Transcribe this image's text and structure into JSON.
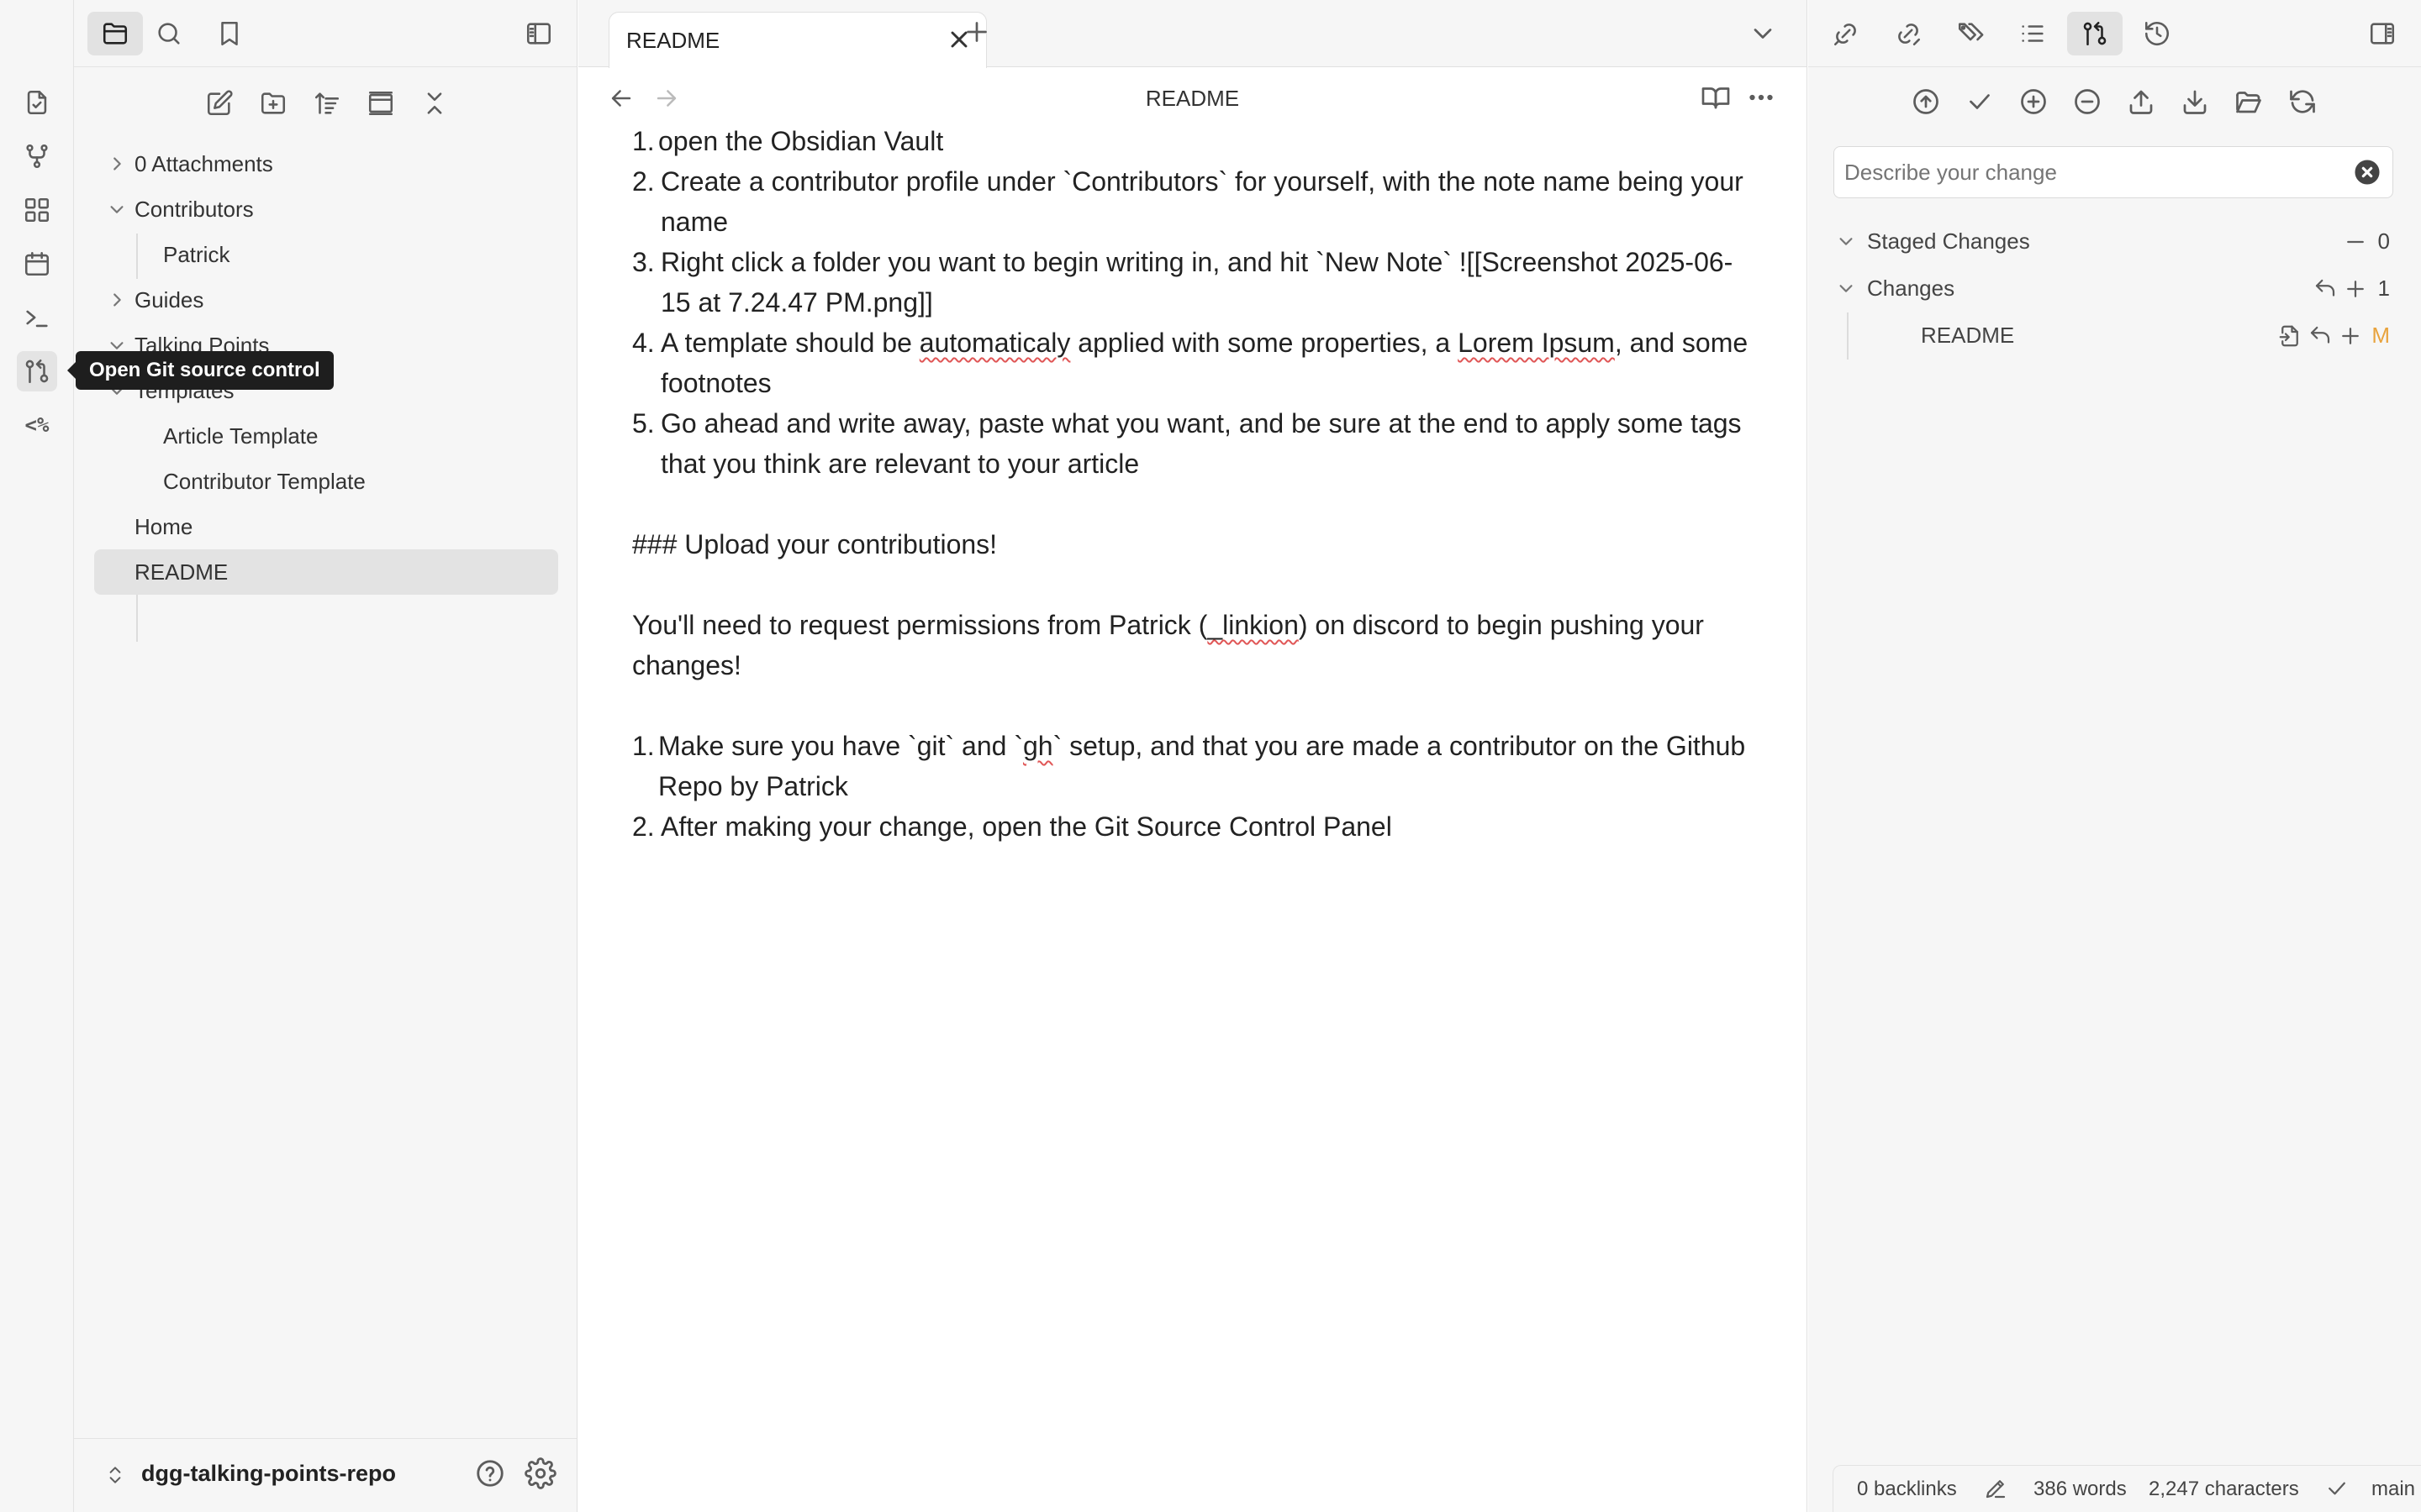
{
  "tooltip": "Open Git source control",
  "ribbon": {
    "template_label": "<%"
  },
  "left_panel": {
    "tree": [
      {
        "label": "0 Attachments",
        "type": "folder",
        "expanded": false
      },
      {
        "label": "Contributors",
        "type": "folder",
        "expanded": true
      },
      {
        "label": "Patrick",
        "type": "file",
        "child": true
      },
      {
        "label": "Guides",
        "type": "folder",
        "expanded": false
      },
      {
        "label": "Talking Points",
        "type": "folder",
        "expanded": true
      },
      {
        "label": "Templates",
        "type": "folder",
        "expanded": true
      },
      {
        "label": "Article Template",
        "type": "file",
        "child": true
      },
      {
        "label": "Contributor Template",
        "type": "file",
        "child": true
      },
      {
        "label": "Home",
        "type": "file"
      },
      {
        "label": "README",
        "type": "file",
        "selected": true
      }
    ],
    "vault_name": "dgg-talking-points-repo"
  },
  "editor": {
    "tab_title": "README",
    "view_title": "README",
    "list1": [
      {
        "num": "1.",
        "text": "open the Obsidian Vault"
      },
      {
        "num": "2.",
        "text": "Create a contributor profile under `Contributors` for yourself, with the note name being your name"
      },
      {
        "num": "3.",
        "text": "Right click a folder you want to begin writing in, and hit `New Note` ![[Screenshot 2025-06-15 at 7.24.47 PM.png]]"
      },
      {
        "num": "4.",
        "pre": "A template should be ",
        "sq1": "automaticaly",
        "mid": " applied with some properties, a ",
        "sq2": "Lorem Ipsum",
        "post": ", and some footnotes"
      },
      {
        "num": "5.",
        "text": "Go ahead and write away, paste what you want, and be sure at the end to apply some tags that you think are relevant to your article"
      }
    ],
    "heading": "### Upload your contributions!",
    "para_pre": "You'll need to request permissions from Patrick (",
    "para_sq": "_linkion",
    "para_post": ") on discord to begin pushing your changes!",
    "list2": [
      {
        "num": "1.",
        "pre": "Make sure you have `git` and `",
        "sq": "gh",
        "post": "` setup, and that you are made a contributor on the Github Repo by Patrick"
      },
      {
        "num": "2.",
        "text": "After making your change, open the Git Source Control Panel"
      }
    ]
  },
  "git": {
    "commit_placeholder": "Describe your change",
    "staged_label": "Staged Changes",
    "staged_count": "0",
    "changes_label": "Changes",
    "changes_count": "1",
    "file_name": "README",
    "file_status": "M"
  },
  "status": {
    "backlinks": "0 backlinks",
    "words": "386 words",
    "characters": "2,247 characters",
    "branch": "main"
  },
  "colors": {
    "modified": "#e8a33d",
    "tooltip_bg": "#1e1e1e"
  }
}
